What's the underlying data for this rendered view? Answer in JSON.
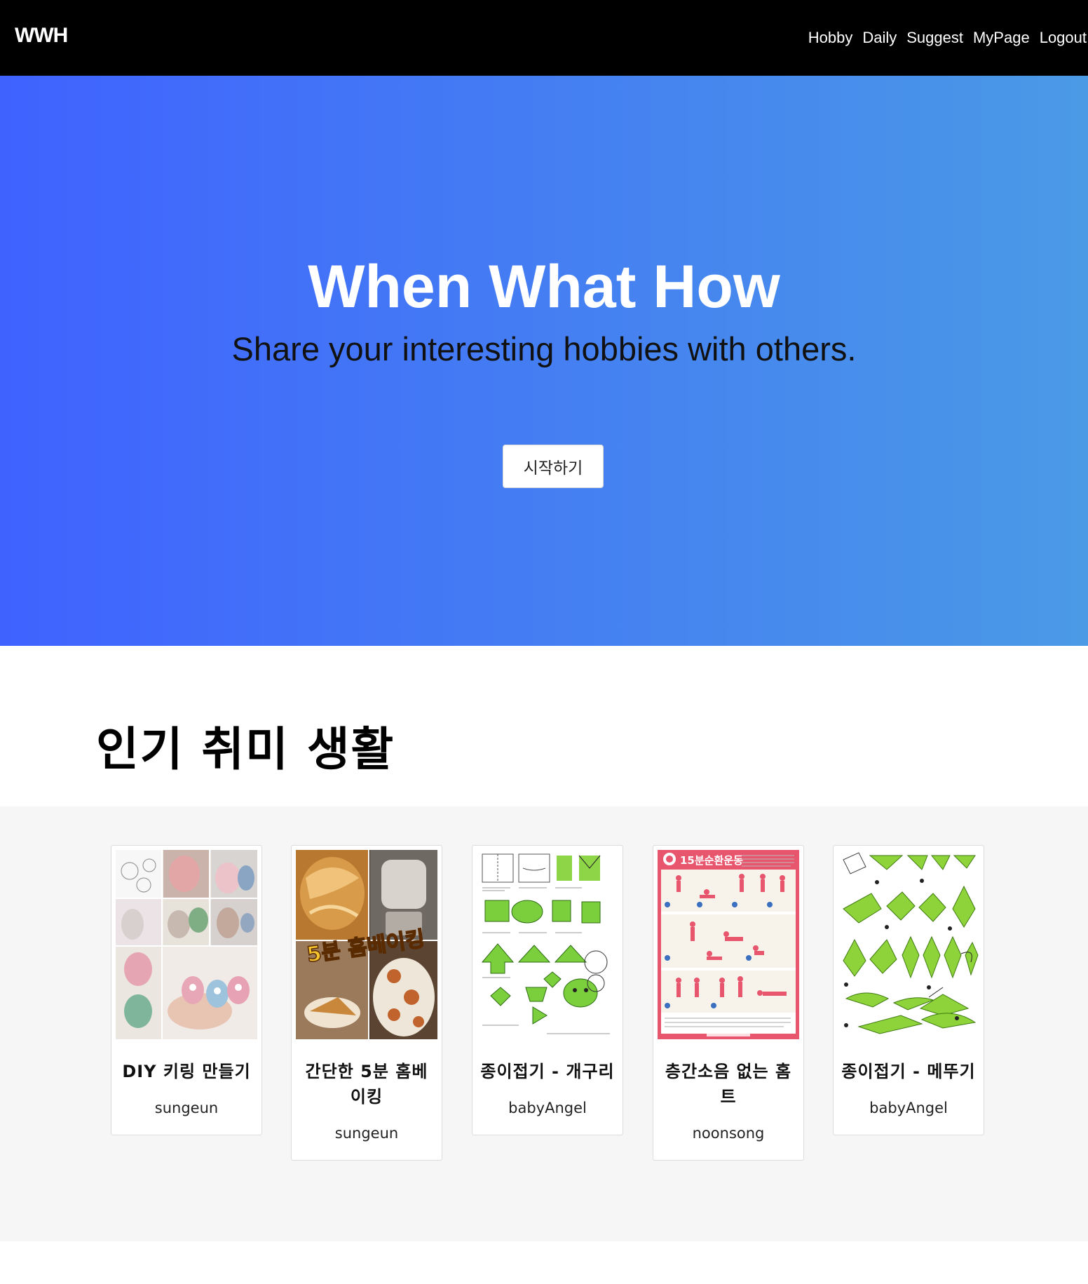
{
  "nav": {
    "brand": "WWH",
    "links": [
      "Hobby",
      "Daily",
      "Suggest",
      "MyPage",
      "Logout"
    ]
  },
  "hero": {
    "title": "When What How",
    "subtitle": "Share your interesting hobbies with others.",
    "button": "시작하기",
    "gradient_start": "#3f62ff",
    "gradient_end": "#4a9ae6"
  },
  "popular": {
    "title": "인기 취미 생활",
    "cards": [
      {
        "title": "DIY 키링 만들기",
        "author": "sungeun",
        "thumb": "keyring-photo-collage"
      },
      {
        "title": "간단한 5분 홈베이킹",
        "author": "sungeun",
        "thumb": "home-baking-photo",
        "thumb_text": "5분 홈베이킹"
      },
      {
        "title": "종이접기 - 개구리",
        "author": "babyAngel",
        "thumb": "origami-frog-diagram"
      },
      {
        "title": "층간소음 없는 홈트",
        "author": "noonsong",
        "thumb": "home-workout-poster",
        "thumb_text": "15분순환운동"
      },
      {
        "title": "종이접기 - 메뚜기",
        "author": "babyAngel",
        "thumb": "origami-grasshopper-diagram"
      }
    ]
  }
}
